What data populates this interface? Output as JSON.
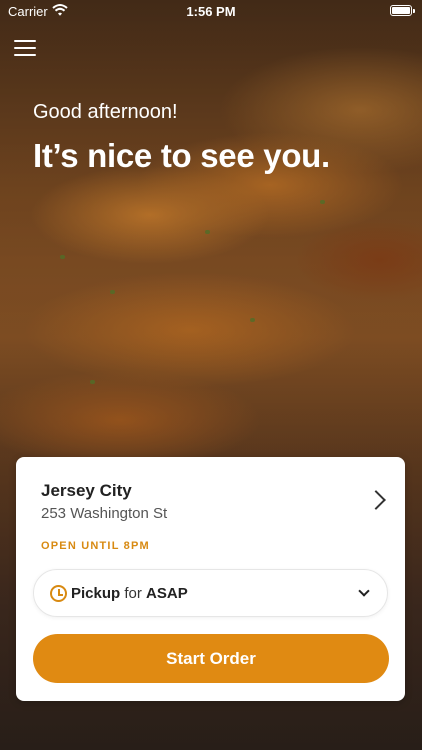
{
  "status_bar": {
    "carrier": "Carrier",
    "time": "1:56 PM"
  },
  "hero": {
    "greeting": "Good afternoon!",
    "headline": "It’s nice to see you."
  },
  "location_card": {
    "store_name": "Jersey City",
    "address": "253 Washington St",
    "hours": "OPEN UNTIL 8PM",
    "pickup": {
      "mode": "Pickup",
      "connector": "for",
      "time": "ASAP"
    },
    "start_order_label": "Start Order"
  },
  "colors": {
    "accent": "#e08a12"
  },
  "icons": [
    "wifi-icon",
    "battery-icon",
    "menu-icon",
    "chevron-right-icon",
    "clock-icon",
    "chevron-down-icon"
  ]
}
